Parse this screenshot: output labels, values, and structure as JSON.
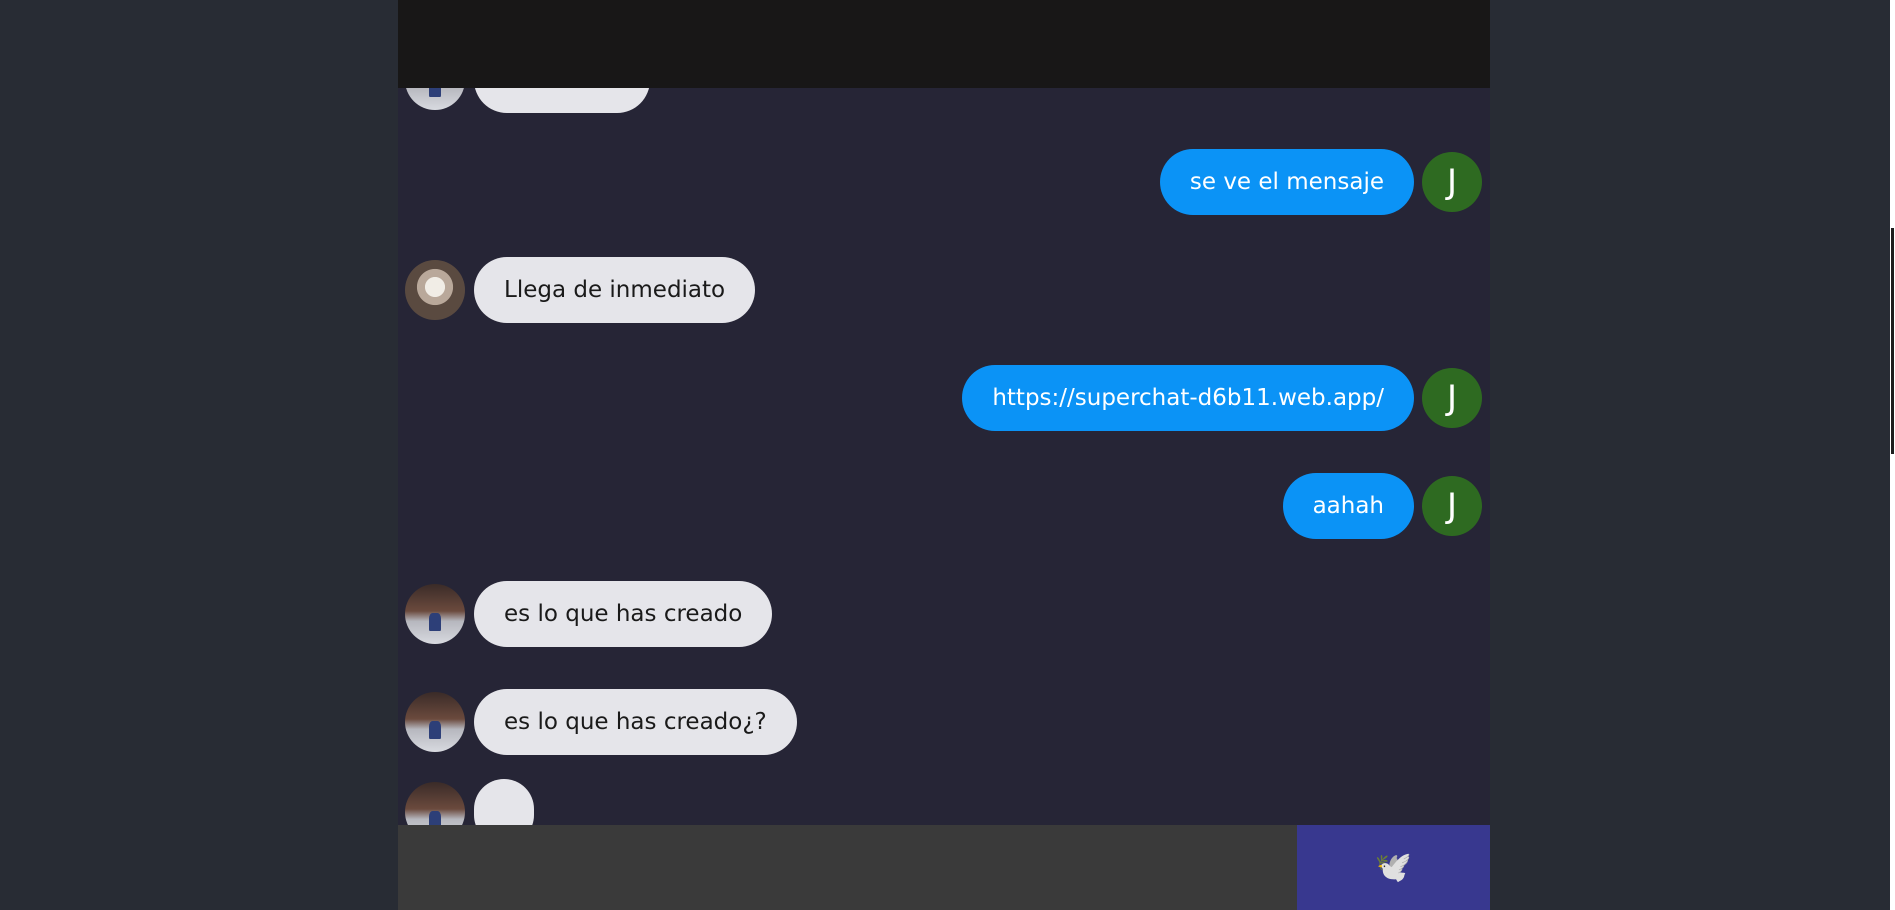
{
  "header": {},
  "messages": [
    {
      "side": "received",
      "avatar": "photo-b",
      "text": ""
    },
    {
      "side": "sent",
      "initial": "J",
      "text": "se ve el mensaje"
    },
    {
      "side": "received",
      "avatar": "photo-a",
      "text": "Llega de inmediato"
    },
    {
      "side": "sent",
      "initial": "J",
      "text": "https://superchat-d6b11.web.app/"
    },
    {
      "side": "sent",
      "initial": "J",
      "text": "aahah"
    },
    {
      "side": "received",
      "avatar": "photo-b",
      "text": "es lo que has creado"
    },
    {
      "side": "received",
      "avatar": "photo-b",
      "text": "es lo que has creado¿?"
    },
    {
      "side": "received",
      "avatar": "photo-b",
      "text": ""
    }
  ],
  "form": {
    "input_value": "",
    "send_icon": "dove-icon",
    "send_glyph": "🕊️"
  },
  "colors": {
    "sent_bubble": "#0b93f6",
    "received_bubble": "#e5e5ea",
    "avatar_initial_bg": "#2e6a21",
    "send_button": "#38388f",
    "header": "#181717"
  }
}
